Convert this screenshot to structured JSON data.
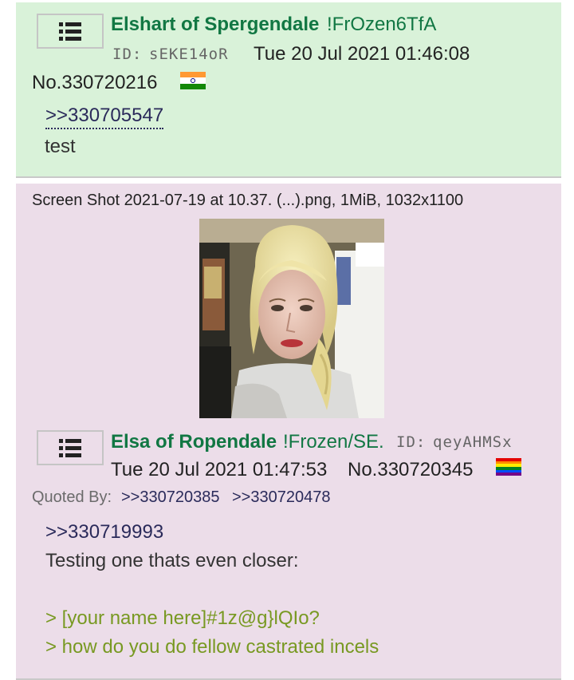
{
  "post1": {
    "name": "Elshart of Spergendale",
    "tripcode": "!FrOzen6TfA",
    "id_label": "ID:",
    "poster_id": "sEKE14oR",
    "date": "Tue 20 Jul 2021 01:46:08",
    "number": "No.330720216",
    "flag": "india-flag",
    "quote": ">>330705547",
    "body": "test"
  },
  "post2": {
    "file_info": "Screen Shot 2021-07-19 at 10.37. (...).png, 1MiB, 1032x1100",
    "name": "Elsa of Ropendale",
    "tripcode": "!Frozen/SE.",
    "id_label": "ID:",
    "poster_id": "qeyAHMSx",
    "date": "Tue 20 Jul 2021 01:47:53",
    "number": "No.330720345",
    "flag": "rainbow-flag",
    "quoted_by_label": "Quoted By:",
    "quoted_by": [
      ">>330720385",
      ">>330720478"
    ],
    "quote": ">>330719993",
    "body_line1": "Testing one thats even closer:",
    "greentext": [
      "> [your name here]#1z@g}lQIo?",
      "> how do you do fellow castrated incels"
    ]
  },
  "colors": {
    "post1_bg": "#d9f2d9",
    "post2_bg": "#ecdde9",
    "name": "#117743",
    "greentext": "#789922",
    "link": "#2a2a5a"
  },
  "icons": [
    "menu-list-icon"
  ]
}
